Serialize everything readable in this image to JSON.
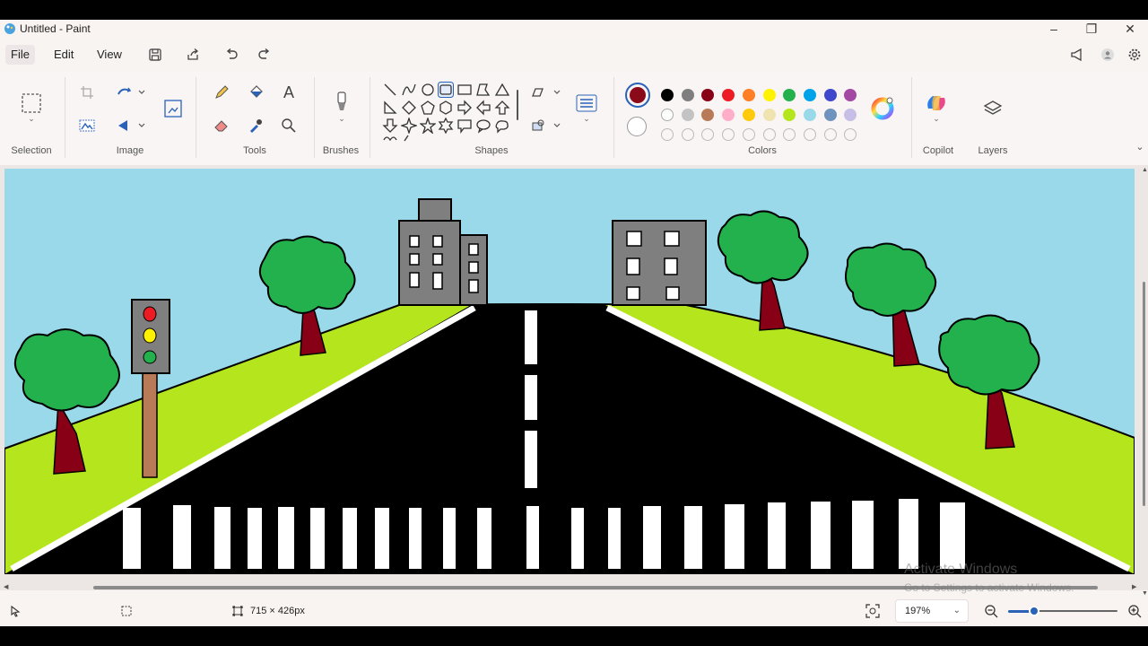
{
  "window": {
    "title": "Untitled - Paint",
    "controls": {
      "minimize": "–",
      "maximize": "❐",
      "close": "✕"
    }
  },
  "menu": {
    "items": [
      "File",
      "Edit",
      "View"
    ]
  },
  "ribbon": {
    "groups": {
      "selection": "Selection",
      "image": "Image",
      "tools": "Tools",
      "brushes": "Brushes",
      "shapes": "Shapes",
      "colors": "Colors",
      "copilot": "Copilot",
      "layers": "Layers"
    },
    "colors": {
      "primary": "#8b0a1a",
      "secondary": "#ffffff",
      "row1": [
        "#000000",
        "#7f7f7f",
        "#880015",
        "#ed1c24",
        "#ff7f27",
        "#fff200",
        "#22b14c",
        "#00a2e8",
        "#3f48cc",
        "#a349a4"
      ],
      "row2": [
        "#ffffff",
        "#c3c3c3",
        "#b97a57",
        "#ffaec9",
        "#ffc90e",
        "#efe4b0",
        "#b5e61d",
        "#99d9ea",
        "#7092be",
        "#c8bfe7"
      ],
      "row3_empty_count": 10
    }
  },
  "status": {
    "canvas_size": "715 × 426px",
    "zoom": "197%"
  },
  "watermark": {
    "line1": "Activate Windows",
    "line2": "Go to Settings to activate Windows."
  },
  "drawing": {
    "sky": "#99d9ea",
    "grass": "#b5e61d",
    "road": "#000000",
    "tree_leaves": "#22b14c",
    "tree_trunk": "#880015",
    "building": "#7f7f7f",
    "pole": "#b97a57",
    "light_colors": [
      "#ed1c24",
      "#fff200",
      "#22b14c"
    ]
  }
}
